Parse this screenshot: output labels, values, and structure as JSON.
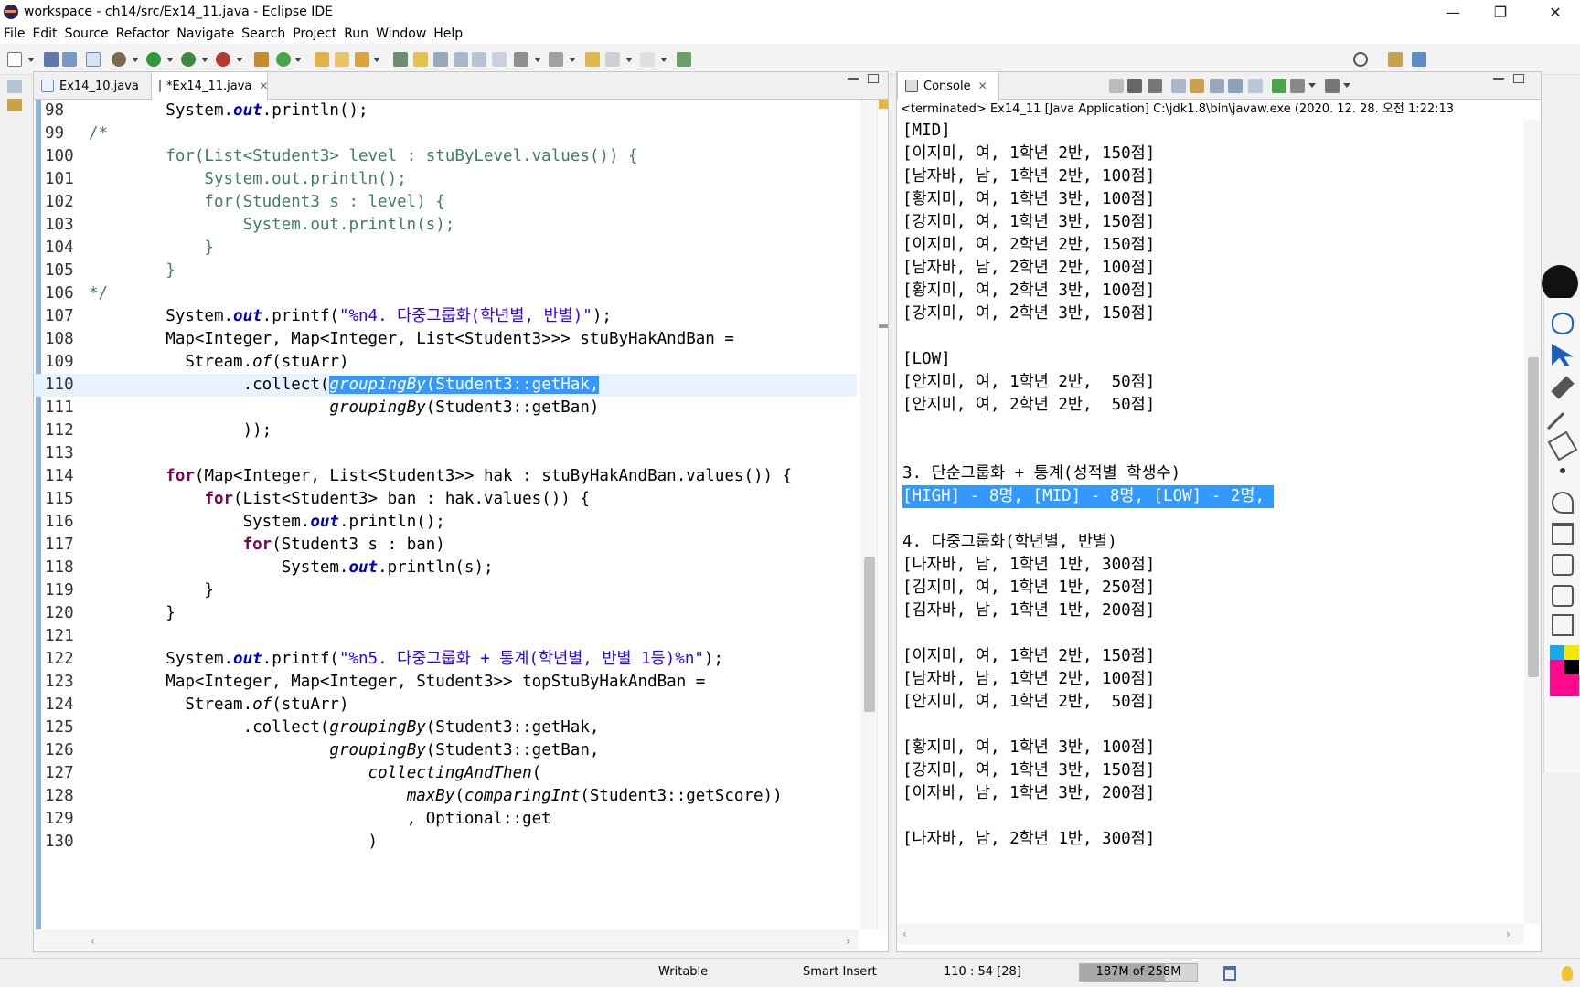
{
  "window": {
    "title": "workspace - ch14/src/Ex14_11.java - Eclipse IDE",
    "minimize": "—",
    "maximize": "❐",
    "close": "✕"
  },
  "menu": [
    "File",
    "Edit",
    "Source",
    "Refactor",
    "Navigate",
    "Search",
    "Project",
    "Run",
    "Window",
    "Help"
  ],
  "editor": {
    "tabs": [
      {
        "label": "Ex14_10.java",
        "active": false
      },
      {
        "label": "*Ex14_11.java",
        "active": true
      }
    ],
    "current_line": 110
  },
  "code_lines": [
    {
      "n": "98",
      "text": "        System.out.println();"
    },
    {
      "n": "99",
      "text": "/*"
    },
    {
      "n": "100",
      "text": "        for(List<Student3> level : stuByLevel.values()) {"
    },
    {
      "n": "101",
      "text": "            System.out.println();"
    },
    {
      "n": "102",
      "text": "            for(Student3 s : level) {"
    },
    {
      "n": "103",
      "text": "                System.out.println(s);"
    },
    {
      "n": "104",
      "text": "            }"
    },
    {
      "n": "105",
      "text": "        }"
    },
    {
      "n": "106",
      "text": "*/"
    },
    {
      "n": "107",
      "text": "        System.out.printf(\"%n4. 다중그룹화(학년별, 반별)\");"
    },
    {
      "n": "108",
      "text": "        Map<Integer, Map<Integer, List<Student3>>> stuByHakAndBan ="
    },
    {
      "n": "109",
      "text": "          Stream.of(stuArr)"
    },
    {
      "n": "110",
      "text": "                .collect(groupingBy(Student3::getHak,"
    },
    {
      "n": "111",
      "text": "                         groupingBy(Student3::getBan)"
    },
    {
      "n": "112",
      "text": "                ));"
    },
    {
      "n": "113",
      "text": ""
    },
    {
      "n": "114",
      "text": "        for(Map<Integer, List<Student3>> hak : stuByHakAndBan.values()) {"
    },
    {
      "n": "115",
      "text": "            for(List<Student3> ban : hak.values()) {"
    },
    {
      "n": "116",
      "text": "                System.out.println();"
    },
    {
      "n": "117",
      "text": "                for(Student3 s : ban)"
    },
    {
      "n": "118",
      "text": "                    System.out.println(s);"
    },
    {
      "n": "119",
      "text": "            }"
    },
    {
      "n": "120",
      "text": "        }"
    },
    {
      "n": "121",
      "text": ""
    },
    {
      "n": "122",
      "text": "        System.out.printf(\"%n5. 다중그룹화 + 통계(학년별, 반별 1등)%n\");"
    },
    {
      "n": "123",
      "text": "        Map<Integer, Map<Integer, Student3>> topStuByHakAndBan ="
    },
    {
      "n": "124",
      "text": "          Stream.of(stuArr)"
    },
    {
      "n": "125",
      "text": "                .collect(groupingBy(Student3::getHak,"
    },
    {
      "n": "126",
      "text": "                         groupingBy(Student3::getBan,"
    },
    {
      "n": "127",
      "text": "                             collectingAndThen("
    },
    {
      "n": "128",
      "text": "                                 maxBy(comparingInt(Student3::getScore))"
    },
    {
      "n": "129",
      "text": "                                 , Optional::get"
    },
    {
      "n": "130",
      "text": "                             )"
    }
  ],
  "console": {
    "tab_label": "Console",
    "status": "<terminated> Ex14_11 [Java Application] C:\\jdk1.8\\bin\\javaw.exe (2020. 12. 28. 오전 1:22:13",
    "lines": [
      "[MID]",
      "[이지미, 여, 1학년 2반, 150점]",
      "[남자바, 남, 1학년 2반, 100점]",
      "[황지미, 여, 1학년 3반, 100점]",
      "[강지미, 여, 1학년 3반, 150점]",
      "[이지미, 여, 2학년 2반, 150점]",
      "[남자바, 남, 2학년 2반, 100점]",
      "[황지미, 여, 2학년 3반, 100점]",
      "[강지미, 여, 2학년 3반, 150점]",
      "",
      "[LOW]",
      "[안지미, 여, 1학년 2반,  50점]",
      "[안지미, 여, 2학년 2반,  50점]",
      "",
      "",
      "3. 단순그룹화 + 통계(성적별 학생수)",
      "[HIGH] - 8명, [MID] - 8명, [LOW] - 2명,",
      "",
      "4. 다중그룹화(학년별, 반별)",
      "[나자바, 남, 1학년 1반, 300점]",
      "[김지미, 여, 1학년 1반, 250점]",
      "[김자바, 남, 1학년 1반, 200점]",
      "",
      "[이지미, 여, 1학년 2반, 150점]",
      "[남자바, 남, 1학년 2반, 100점]",
      "[안지미, 여, 1학년 2반,  50점]",
      "",
      "[황지미, 여, 1학년 3반, 100점]",
      "[강지미, 여, 1학년 3반, 150점]",
      "[이자바, 남, 1학년 3반, 200점]",
      "",
      "[나자바, 남, 2학년 1반, 300점]"
    ],
    "highlight_index": 16
  },
  "status": {
    "writable": "Writable",
    "insert_mode": "Smart Insert",
    "position": "110 : 54 [28]",
    "heap": "187M of 258M",
    "heap_used_fraction": 0.725
  },
  "colors": {
    "keyword": "#7f0055",
    "string": "#2a00ff",
    "comment": "#3f7f5f",
    "static_field": "#0000c0",
    "selection": "#3399ff"
  }
}
